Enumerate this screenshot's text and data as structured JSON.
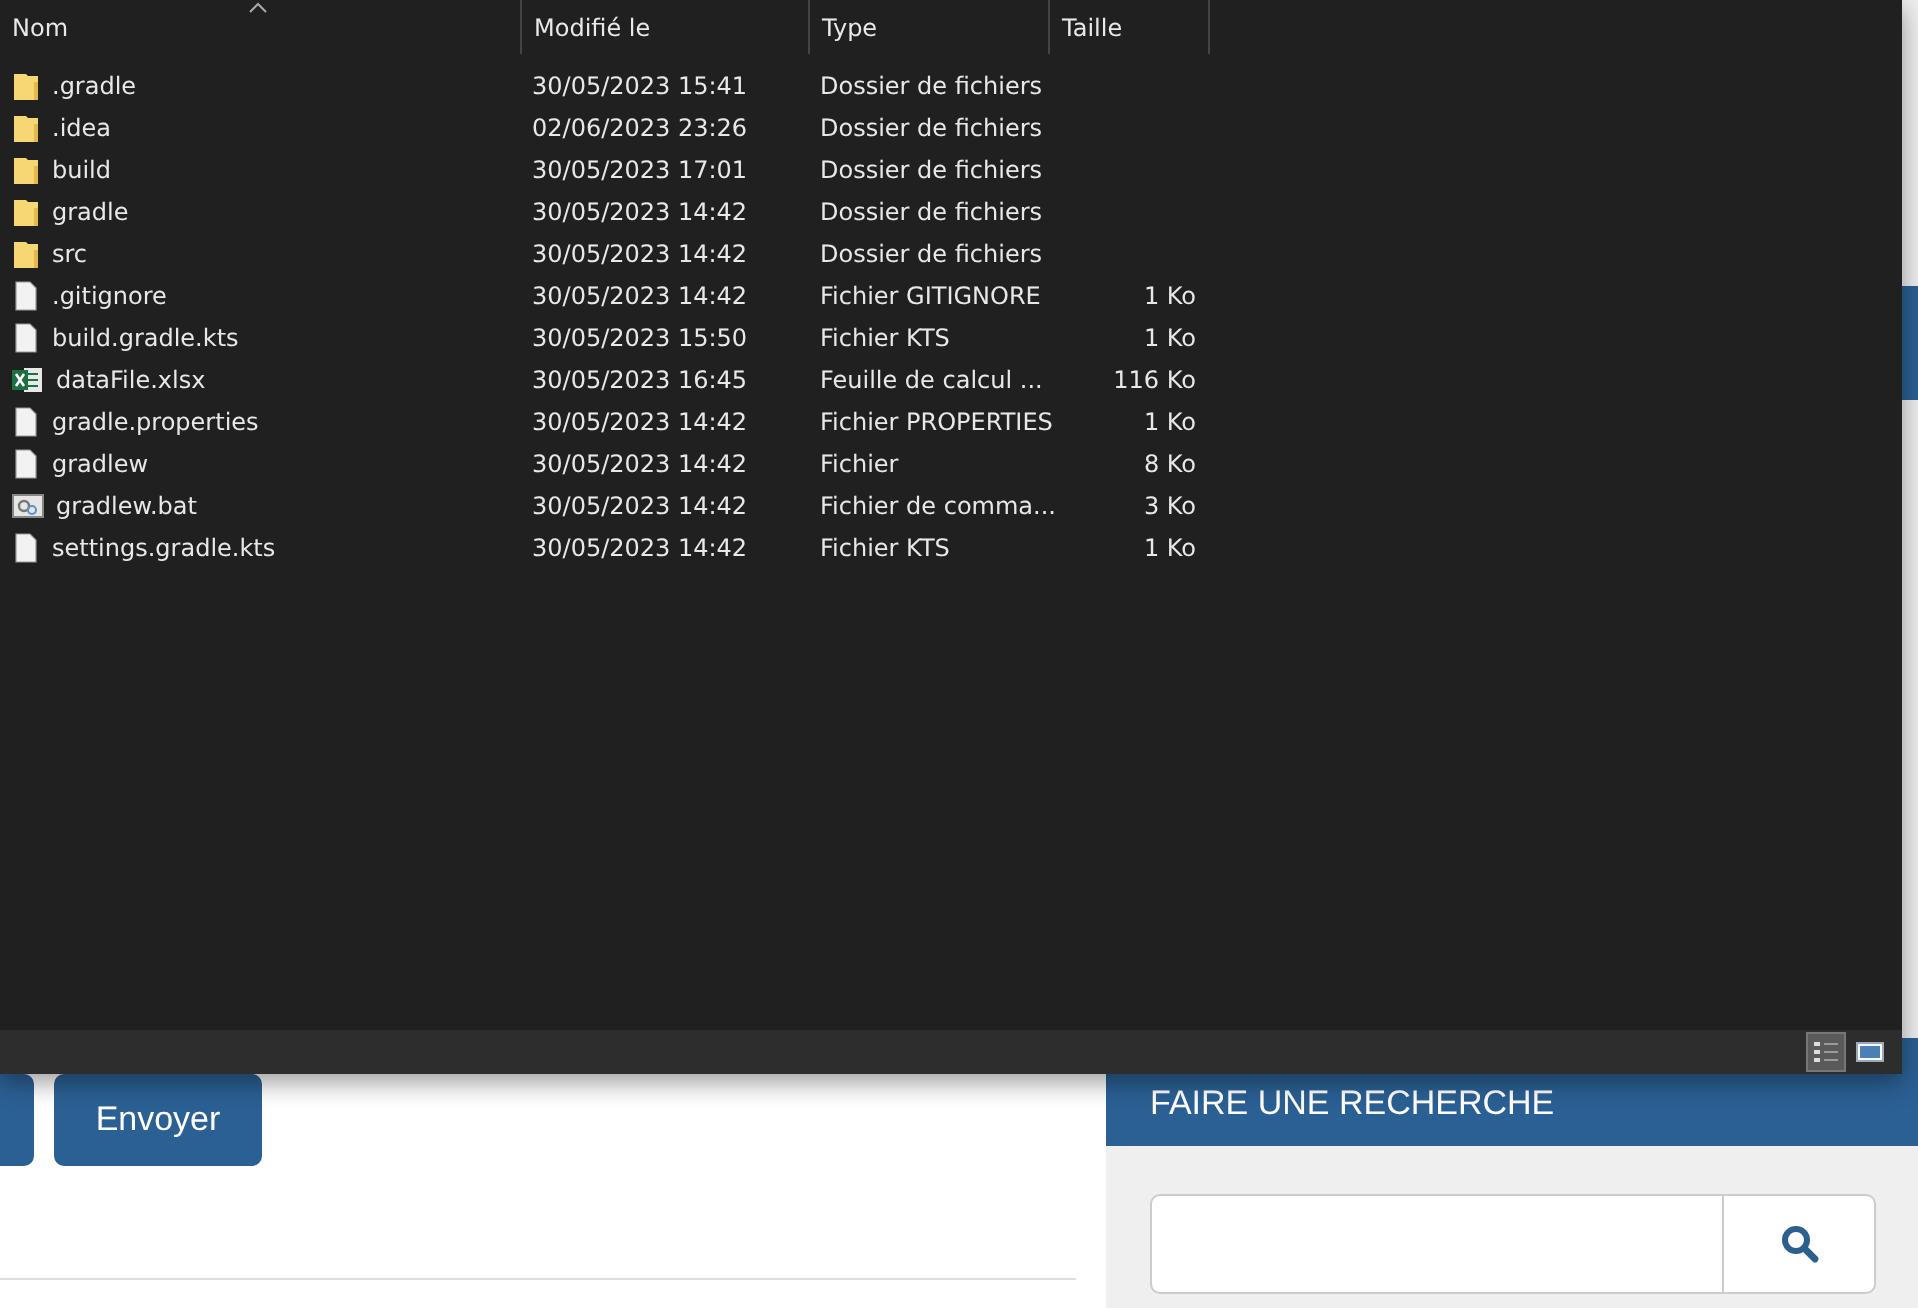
{
  "page": {
    "buttons": [
      "Envoyer"
    ],
    "sidebar_heading": "FAIRE UNE RECHERCHE"
  },
  "dialog": {
    "columns": [
      "Nom",
      "Modifié le",
      "Type",
      "Taille"
    ],
    "rows": [
      {
        "kind": "folder",
        "name": ".gradle",
        "modified": "30/05/2023 15:41",
        "type": "Dossier de fichiers"
      },
      {
        "kind": "folder",
        "name": ".idea",
        "modified": "02/06/2023 23:26",
        "type": "Dossier de fichiers"
      },
      {
        "kind": "folder",
        "name": "build",
        "modified": "30/05/2023 17:01",
        "type": "Dossier de fichiers"
      },
      {
        "kind": "folder",
        "name": "gradle",
        "modified": "30/05/2023 14:42",
        "type": "Dossier de fichiers"
      },
      {
        "kind": "folder",
        "name": "src",
        "modified": "30/05/2023 14:42",
        "type": "Dossier de fichiers"
      },
      {
        "kind": "file",
        "name": ".gitignore",
        "modified": "30/05/2023 14:42",
        "type": "Fichier GITIGNORE",
        "size": "1 Ko"
      },
      {
        "kind": "file",
        "name": "build.gradle.kts",
        "modified": "30/05/2023 15:50",
        "type": "Fichier KTS",
        "size": "1 Ko"
      },
      {
        "kind": "spreadsheet",
        "name": "dataFile.xlsx",
        "modified": "30/05/2023 16:45",
        "type": "Feuille de calcul ...",
        "size": "116 Ko"
      },
      {
        "kind": "file",
        "name": "gradle.properties",
        "modified": "30/05/2023 14:42",
        "type": "Fichier PROPERTIES",
        "size": "1 Ko"
      },
      {
        "kind": "file",
        "name": "gradlew",
        "modified": "30/05/2023 14:42",
        "type": "Fichier",
        "size": "8 Ko"
      },
      {
        "kind": "batch",
        "name": "gradlew.bat",
        "modified": "30/05/2023 14:42",
        "type": "Fichier de comma...",
        "size": "3 Ko"
      },
      {
        "kind": "file",
        "name": "settings.gradle.kts",
        "modified": "30/05/2023 14:42",
        "type": "Fichier KTS",
        "size": "1 Ko"
      }
    ],
    "views": [
      {
        "kind": "details",
        "selected": true
      },
      {
        "kind": "large",
        "selected": false
      }
    ]
  }
}
